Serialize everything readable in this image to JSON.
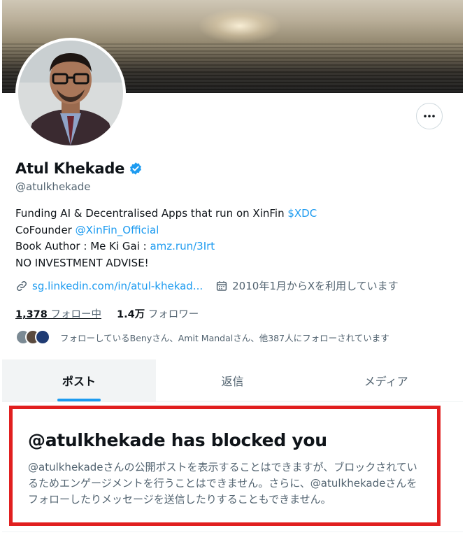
{
  "profile": {
    "name": "Atul Khekade",
    "handle": "@atulkhekade",
    "bio": [
      {
        "text": "Funding AI & Decentralised Apps that run on XinFin ",
        "link": "$XDC"
      },
      {
        "text": "CoFounder ",
        "link": "@XinFin_Official"
      },
      {
        "text": "Book Author : Me Ki Gai : ",
        "link": "amz.run/3Irt"
      },
      {
        "text": "NO INVESTMENT ADVISE!",
        "link": ""
      }
    ],
    "website": "sg.linkedin.com/in/atul-khekad...",
    "joined": "2010年1月からXを利用しています",
    "following_count": "1,378",
    "following_label": "フォロー中",
    "followers_count": "1.4万",
    "followers_label": "フォロワー",
    "followed_by_text": "フォローしているBenyさん、Amit Mandalさん、他387人にフォローされています"
  },
  "icons": {
    "more": "more-horizontal-icon",
    "verified": "verified-badge-icon",
    "link": "link-icon",
    "calendar": "calendar-icon"
  },
  "colors": {
    "accent": "#1d9bf0",
    "block_border": "#e11f1f",
    "secondary_text": "#536471"
  },
  "tabs": [
    {
      "label": "ポスト",
      "active": true
    },
    {
      "label": "返信",
      "active": false
    },
    {
      "label": "メディア",
      "active": false
    }
  ],
  "blocked": {
    "title": "@atulkhekade has blocked you",
    "body": "@atulkhekadeさんの公開ポストを表示することはできますが、ブロックされているためエンゲージメントを行うことはできません。さらに、@atulkhekadeさんをフォローしたりメッセージを送信したりすることもできません。"
  }
}
